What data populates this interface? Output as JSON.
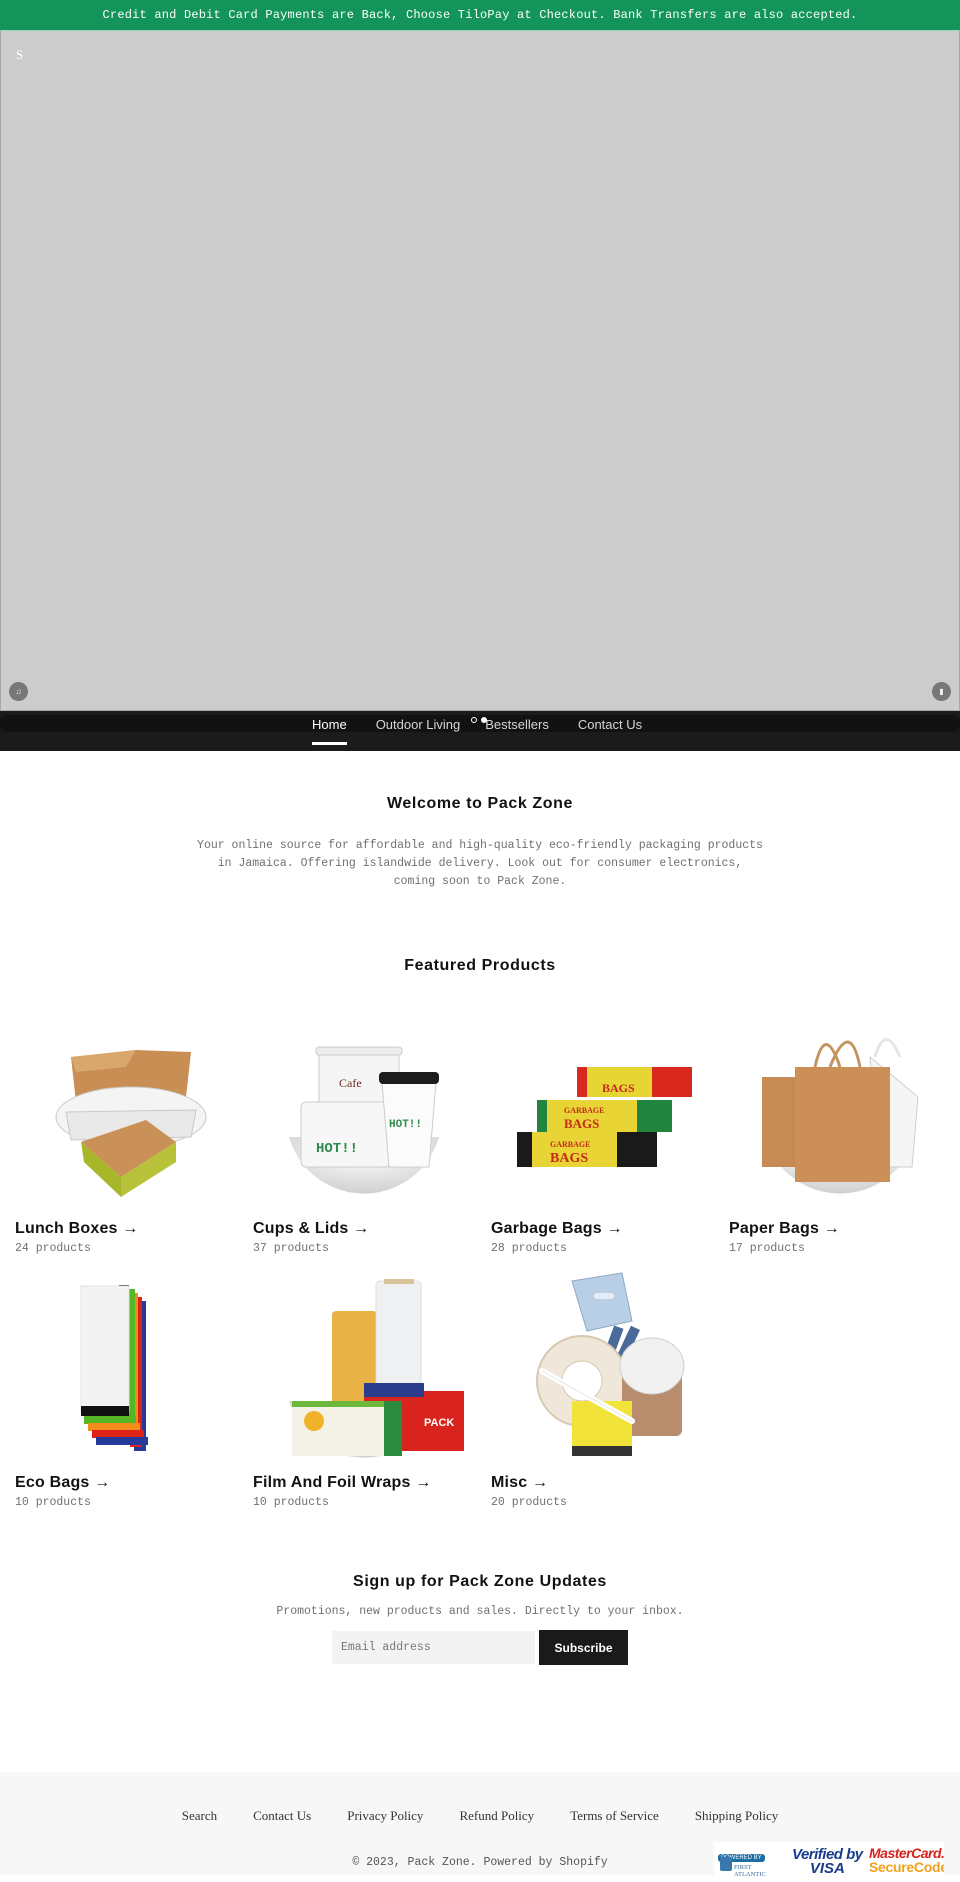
{
  "announcement": {
    "text": "Credit and Debit Card Payments are Back, Choose TiloPay at Checkout. Bank Transfers are also accepted.",
    "background": "#13945a"
  },
  "hero": {
    "corner_letter": "S",
    "prev_icon": "music-note-icon",
    "next_icon": "pause-icon"
  },
  "nav": {
    "items": [
      {
        "label": "Home",
        "active": true
      },
      {
        "label": "Outdoor Living",
        "active": false
      },
      {
        "label": "Bestsellers",
        "active": false
      },
      {
        "label": "Contact Us",
        "active": false
      }
    ],
    "slide_dots": 2,
    "active_dot": 2
  },
  "welcome": {
    "title": "Welcome to Pack Zone",
    "body": "Your online source for affordable and high-quality eco-friendly packaging products in Jamaica. Offering islandwide delivery. Look out for consumer electronics, coming soon to Pack Zone."
  },
  "featured": {
    "title": "Featured Products",
    "collections": [
      {
        "title": "Lunch Boxes →",
        "count": "24 products",
        "image": "lunch-boxes-image"
      },
      {
        "title": "Cups & Lids →",
        "count": "37 products",
        "image": "cups-lids-image"
      },
      {
        "title": "Garbage Bags →",
        "count": "28 products",
        "image": "garbage-bags-image"
      },
      {
        "title": "Paper Bags →",
        "count": "17 products",
        "image": "paper-bags-image"
      },
      {
        "title": "Eco Bags →",
        "count": "10 products",
        "image": "eco-bags-image"
      },
      {
        "title": "Film And Foil Wraps →",
        "count": "10 products",
        "image": "film-foil-wraps-image"
      },
      {
        "title": "Misc →",
        "count": "20 products",
        "image": "misc-image"
      }
    ],
    "image_text": {
      "cafe": "Cafe",
      "hot": "HOT!!",
      "garbage": "GARBAGE",
      "bags": "BAGS",
      "pack": "PACK"
    }
  },
  "newsletter": {
    "title": "Sign up for Pack Zone Updates",
    "subtitle": "Promotions, new products and sales. Directly to your inbox.",
    "email_placeholder": "Email address",
    "email_value": "",
    "subscribe_label": "Subscribe"
  },
  "footer": {
    "links": [
      "Search",
      "Contact Us",
      "Privacy Policy",
      "Refund Policy",
      "Terms of Service",
      "Shipping Policy"
    ],
    "copyright": "© 2023, Pack Zone. Powered by Shopify",
    "badges": {
      "fac_powered": "POWERED BY",
      "fac_name_1": "FIRST",
      "fac_name_2": "ATLANTIC",
      "visa_1": "Verified by",
      "visa_2": "VISA",
      "mc_1": "MasterCard.",
      "mc_2": "SecureCode."
    }
  }
}
